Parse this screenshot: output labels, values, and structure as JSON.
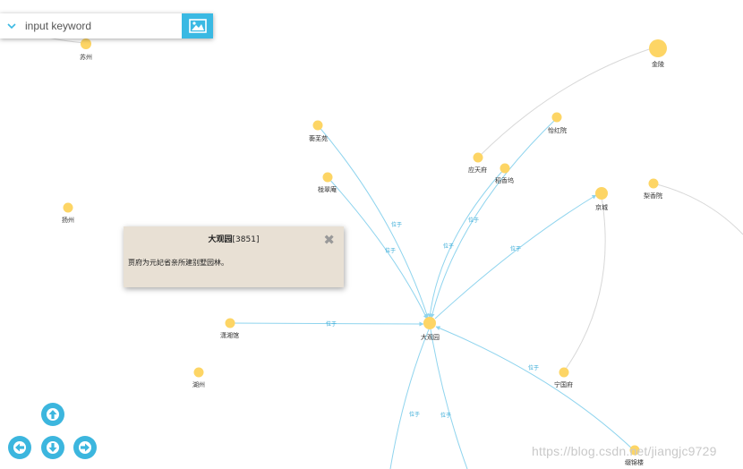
{
  "search": {
    "placeholder": "input keyword"
  },
  "colors": {
    "accent": "#3ab9e3",
    "node": "#fdd565",
    "edge": "#8fd4ee",
    "popup_bg": "#e8e0d4"
  },
  "graph": {
    "nodes": [
      {
        "id": "suzhou",
        "label": "苏州"
      },
      {
        "id": "jinling",
        "label": "金陵"
      },
      {
        "id": "yiyuan",
        "label": "蘅芜苑"
      },
      {
        "id": "yihong",
        "label": "怡红院"
      },
      {
        "id": "yingtian",
        "label": "应天府"
      },
      {
        "id": "daoxiang",
        "label": "稻香坞"
      },
      {
        "id": "longcui",
        "label": "栊翠庵"
      },
      {
        "id": "jingcheng",
        "label": "京城"
      },
      {
        "id": "lixiang",
        "label": "梨香院"
      },
      {
        "id": "yangzhou",
        "label": "扬州"
      },
      {
        "id": "daguanyuan",
        "label": "大观园"
      },
      {
        "id": "xiaoxiang",
        "label": "潇湘馆"
      },
      {
        "id": "huzhou",
        "label": "湖州"
      },
      {
        "id": "ningguo",
        "label": "宁国府"
      },
      {
        "id": "ningguofu",
        "label": "缀锦楼"
      }
    ],
    "edge_label": "位于"
  },
  "popup": {
    "title": "大观园",
    "count": "[3851]",
    "description": "贾府为元妃省亲所建别墅园林。",
    "close_icon": "close-icon"
  },
  "nav": {
    "up": "arrow-up-icon",
    "left": "arrow-left-icon",
    "down": "arrow-down-icon",
    "right": "arrow-right-icon"
  },
  "watermark": "https://blog.csdn.net/jiangjc9729"
}
